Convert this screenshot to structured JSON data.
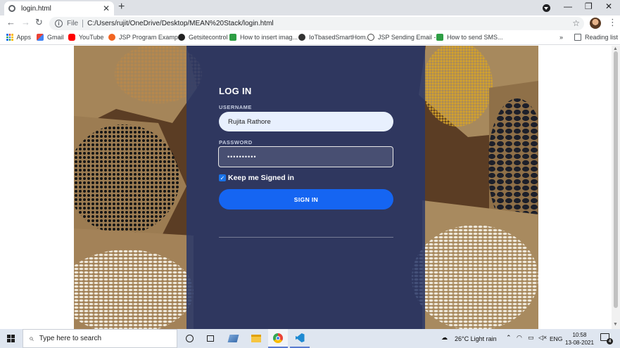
{
  "browser": {
    "tab_title": "login.html",
    "url_scheme": "File",
    "url": "C:/Users/rujit/OneDrive/Desktop/MEAN%20Stack/login.html",
    "bookmarks": [
      {
        "label": "Apps",
        "icon": "apps-grid-icon"
      },
      {
        "label": "Gmail",
        "icon": "gmail-icon"
      },
      {
        "label": "YouTube",
        "icon": "youtube-icon"
      },
      {
        "label": "JSP Program Examp...",
        "icon": "site-favicon"
      },
      {
        "label": "Getsitecontrol",
        "icon": "getsitecontrol-icon"
      },
      {
        "label": "How to insert imag...",
        "icon": "green-s-icon"
      },
      {
        "label": "IoTbasedSmartHom...",
        "icon": "globe-icon"
      },
      {
        "label": "JSP Sending Email -...",
        "icon": "wordpress-icon"
      },
      {
        "label": "How to send SMS...",
        "icon": "green-s-icon"
      }
    ],
    "overflow": "»",
    "reading_list": "Reading list"
  },
  "login": {
    "title": "LOG IN",
    "username_label": "USERNAME",
    "username_value": "Rujita Rathore",
    "password_label": "PASSWORD",
    "password_value": "••••••••••",
    "remember_label": "Keep me Signed in",
    "remember_checked": true,
    "signin_label": "SIGN IN"
  },
  "taskbar": {
    "search_placeholder": "Type here to search",
    "weather": "26°C  Light rain",
    "language": "ENG",
    "time": "10:58",
    "date": "13-08-2021",
    "notifications": "4"
  },
  "colors": {
    "panel": "#28376a",
    "signin_button": "#1565f2",
    "username_bg": "#e8f0fe"
  }
}
